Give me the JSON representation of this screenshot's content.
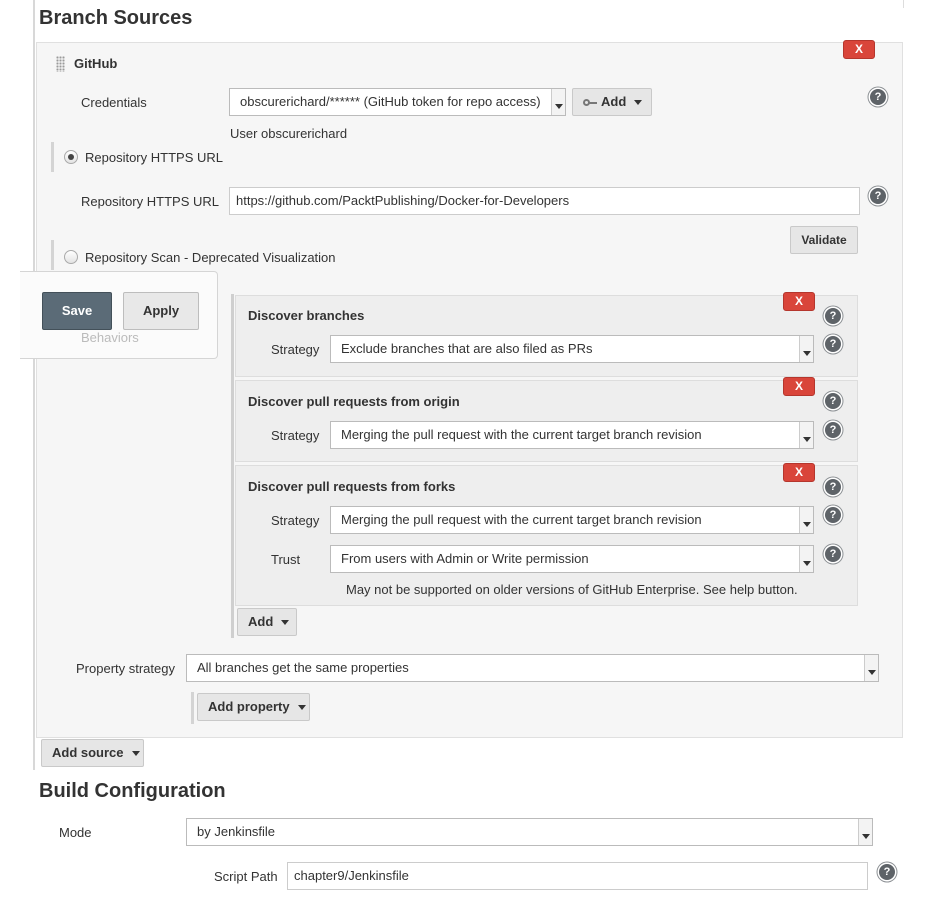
{
  "branch_sources": {
    "title": "Branch Sources",
    "github": {
      "title": "GitHub",
      "delete_label": "X",
      "credentials_label": "Credentials",
      "credentials_value": "obscurerichard/****** (GitHub token for repo access)",
      "add_label": "Add",
      "user_note": "User obscurerichard",
      "radio_https_label": "Repository HTTPS URL",
      "https_url_label": "Repository HTTPS URL",
      "https_url_value": "https://github.com/PacktPublishing/Docker-for-Developers",
      "validate_label": "Validate",
      "radio_scan_label": "Repository Scan - Deprecated Visualization",
      "behaviors_label": "Behaviors",
      "traits": [
        {
          "title": "Discover branches",
          "delete_label": "X",
          "strategy_label": "Strategy",
          "strategy_value": "Exclude branches that are also filed as PRs"
        },
        {
          "title": "Discover pull requests from origin",
          "delete_label": "X",
          "strategy_label": "Strategy",
          "strategy_value": "Merging the pull request with the current target branch revision"
        },
        {
          "title": "Discover pull requests from forks",
          "delete_label": "X",
          "strategy_label": "Strategy",
          "strategy_value": "Merging the pull request with the current target branch revision",
          "trust_label": "Trust",
          "trust_value": "From users with Admin or Write permission",
          "note": "May not be supported on older versions of GitHub Enterprise. See help button."
        }
      ],
      "add_trait_label": "Add",
      "property_strategy_label": "Property strategy",
      "property_strategy_value": "All branches get the same properties",
      "add_property_label": "Add property"
    },
    "add_source_label": "Add source"
  },
  "build_configuration": {
    "title": "Build Configuration",
    "mode_label": "Mode",
    "mode_value": "by Jenkinsfile",
    "script_path_label": "Script Path",
    "script_path_value": "chapter9/Jenkinsfile"
  },
  "floating_actions": {
    "save_label": "Save",
    "apply_label": "Apply"
  },
  "help_glyph": "?",
  "icons": [
    "drag-handle-icon",
    "key-icon",
    "help-icon",
    "chevron-down-icon"
  ],
  "colors": {
    "delete_red": "#d9453a",
    "save_button": "#5b6b77",
    "panel_bg": "#f6f6f6",
    "trait_bg": "#eeeeee"
  }
}
